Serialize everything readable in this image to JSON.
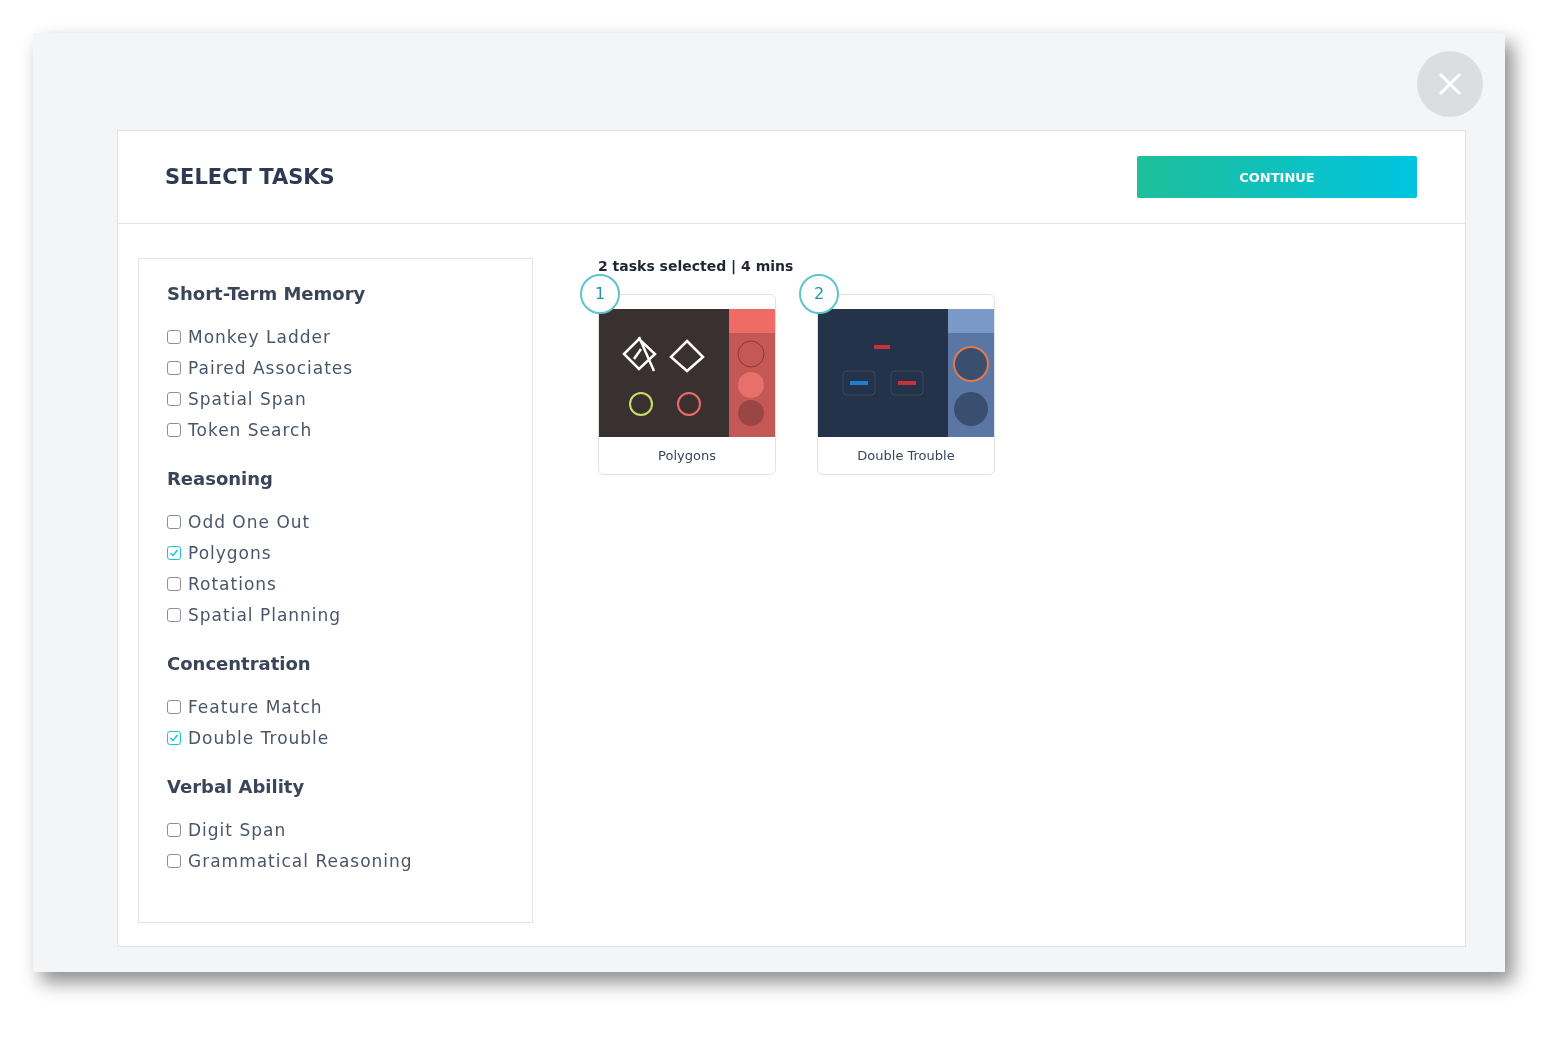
{
  "dialog": {
    "title": "SELECT TASKS",
    "continue_button": "CONTINUE"
  },
  "categories": [
    {
      "name": "Short-Term Memory",
      "tasks": [
        {
          "label": "Monkey Ladder",
          "checked": false
        },
        {
          "label": "Paired Associates",
          "checked": false
        },
        {
          "label": "Spatial Span",
          "checked": false
        },
        {
          "label": "Token Search",
          "checked": false
        }
      ]
    },
    {
      "name": "Reasoning",
      "tasks": [
        {
          "label": "Odd One Out",
          "checked": false
        },
        {
          "label": "Polygons",
          "checked": true
        },
        {
          "label": "Rotations",
          "checked": false
        },
        {
          "label": "Spatial Planning",
          "checked": false
        }
      ]
    },
    {
      "name": "Concentration",
      "tasks": [
        {
          "label": "Feature Match",
          "checked": false
        },
        {
          "label": "Double Trouble",
          "checked": true
        }
      ]
    },
    {
      "name": "Verbal Ability",
      "tasks": [
        {
          "label": "Digit Span",
          "checked": false
        },
        {
          "label": "Grammatical Reasoning",
          "checked": false
        }
      ]
    }
  ],
  "summary": "2 tasks selected | 4 mins",
  "selected_tasks": [
    {
      "number": "1",
      "name": "Polygons",
      "kind": "polygons"
    },
    {
      "number": "2",
      "name": "Double Trouble",
      "kind": "double-trouble"
    }
  ]
}
